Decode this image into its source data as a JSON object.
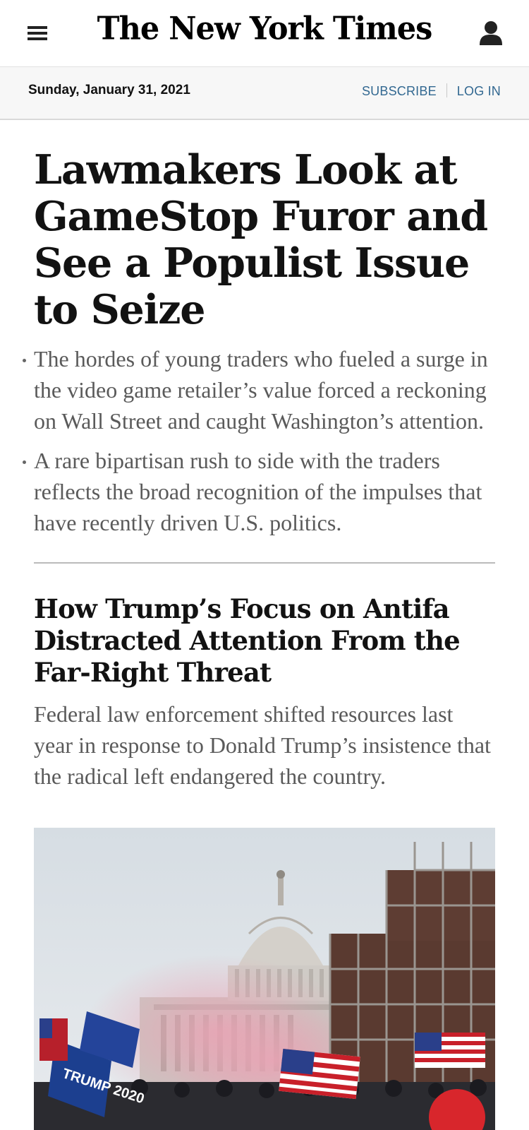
{
  "header": {
    "logo_text": "The New York Times",
    "menu_icon": "hamburger-menu-icon",
    "account_icon": "user-account-icon"
  },
  "datebar": {
    "date": "Sunday, January 31, 2021",
    "subscribe_label": "SUBSCRIBE",
    "login_label": "LOG IN",
    "link_color": "#326891"
  },
  "lead_story": {
    "headline": "Lawmakers Look at GameStop Furor and See a Populist Issue to Seize",
    "bullets": [
      "The hordes of young traders who fueled a surge in the video game retailer’s value forced a reckoning on Wall Street and caught Washington’s attention.",
      "A rare bipartisan rush to side with the traders reflects the broad recognition of the impulses that have recently driven U.S. politics."
    ]
  },
  "second_story": {
    "headline": "How Trump’s Focus on Antifa Distracted Attention From the Far-Right Threat",
    "summary": "Federal law enforcement shifted resources last year in response to Donald Trump’s insistence that the radical left endangered the country.",
    "image_sign_text": "TRUMP 2020"
  }
}
